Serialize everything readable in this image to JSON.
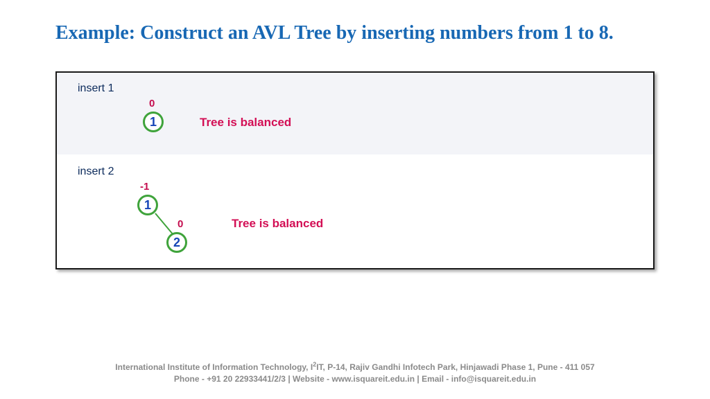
{
  "title": "Example: Construct an AVL Tree by inserting numbers from 1 to 8.",
  "steps": [
    {
      "label": "insert 1",
      "status": "Tree is balanced",
      "nodes": [
        {
          "value": "1",
          "balance": "0"
        }
      ]
    },
    {
      "label": "insert 2",
      "status": "Tree is balanced",
      "nodes": [
        {
          "value": "1",
          "balance": "-1"
        },
        {
          "value": "2",
          "balance": "0"
        }
      ]
    }
  ],
  "footer": {
    "line1_a": "International Institute of Information Technology, I",
    "line1_sup": "2",
    "line1_b": "IT, P-14, Rajiv Gandhi Infotech Park, Hinjawadi Phase 1, Pune - 411 057",
    "line2": "Phone - +91 20 22933441/2/3 | Website - www.isquareit.edu.in | Email - info@isquareit.edu.in"
  }
}
